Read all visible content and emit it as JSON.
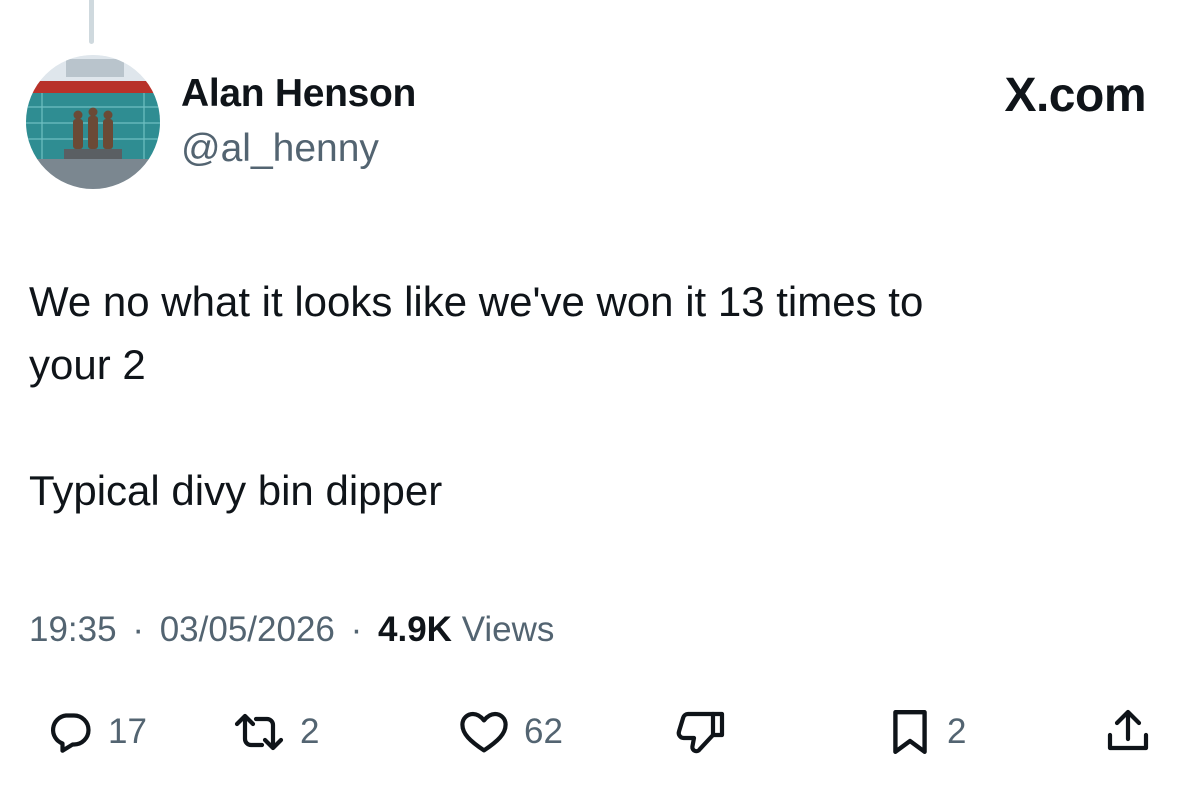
{
  "author": {
    "display_name": "Alan Henson",
    "handle": "@al_henny"
  },
  "brand": "X.com",
  "tweet": {
    "lines": [
      "We no what it looks like we've won it 13 times to",
      "your 2",
      "Typical divy bin dipper"
    ]
  },
  "meta": {
    "time": "19:35",
    "date": "03/05/2026",
    "separator": "·",
    "views_count": "4.9K",
    "views_label": "Views"
  },
  "actions": {
    "reply": {
      "icon": "reply-icon",
      "count": "17"
    },
    "repost": {
      "icon": "repost-icon",
      "count": "2"
    },
    "like": {
      "icon": "heart-icon",
      "count": "62"
    },
    "dislike": {
      "icon": "thumbs-down-icon"
    },
    "bookmark": {
      "icon": "bookmark-icon",
      "count": "2"
    },
    "share": {
      "icon": "share-icon"
    }
  },
  "colors": {
    "text_primary": "#0f1419",
    "text_secondary": "#536471",
    "thread_line": "#cfd9de"
  }
}
